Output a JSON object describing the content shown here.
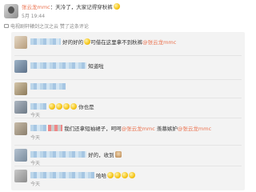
{
  "post": {
    "username": "张云龙mmc",
    "colon": "：",
    "text": "天冷了，大家记得穿秋裤",
    "time": "5月 19:44",
    "tv_line": "电视剧轩辕剑之汉之云 赞了这条评论"
  },
  "comments": [
    {
      "text": "好的好的",
      "mid": "可借在这里拿不到秋裤",
      "mention": "@张云龙mmc",
      "time": ""
    },
    {
      "text": "知道啦",
      "time": ""
    },
    {
      "text": "",
      "time": ""
    },
    {
      "text": "你也是",
      "time": "今天"
    },
    {
      "text": "我们还拿短袖裙子，呵呵",
      "mention": "@张云龙mmc",
      "after": "羡慕嫉妒",
      "mention2": "@张云龙mmc",
      "time": "今天"
    },
    {
      "text": "好的，收到",
      "time": "今天"
    },
    {
      "text": "哈哈",
      "time": "今天"
    }
  ]
}
